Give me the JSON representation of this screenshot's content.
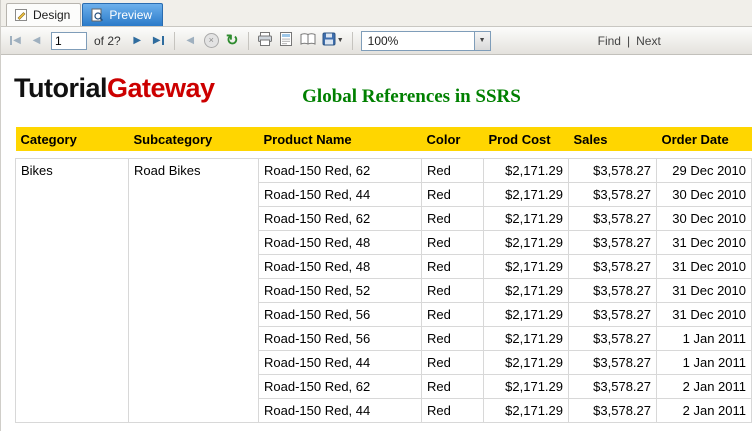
{
  "window": {
    "tabs": {
      "design": "Design",
      "preview": "Preview"
    }
  },
  "toolbar": {
    "page_number": "1",
    "page_count_label": "of 2?",
    "zoom_value": "100%",
    "find_label": "Find",
    "find_separator": "|",
    "next_label": "Next",
    "icons": {
      "first_page": "◀",
      "prev_page": "◀",
      "next_page": "▶",
      "last_page": "▶",
      "back_parent": "◀",
      "stop": "×",
      "refresh": "↻",
      "export_dropdown": "▼",
      "zoom_dropdown": "▼"
    }
  },
  "report": {
    "logo_part1": "Tutorial",
    "logo_part2": "Gateway",
    "title": "Global References in SSRS",
    "colors": {
      "logo_accent": "#CC0000",
      "title_green": "#008000",
      "header_yellow": "#FFD600",
      "active_tab_blue": "#2B7BC8"
    }
  },
  "table": {
    "headers": [
      "Category",
      "Subcategory",
      "Product Name",
      "Color",
      "Prod Cost",
      "Sales",
      "Order Date"
    ],
    "group": {
      "category": "Bikes",
      "subcategory": "Road Bikes"
    },
    "rows": [
      [
        "Road-150 Red, 62",
        "Red",
        "$2,171.29",
        "$3,578.27",
        "29 Dec 2010"
      ],
      [
        "Road-150 Red, 44",
        "Red",
        "$2,171.29",
        "$3,578.27",
        "30 Dec 2010"
      ],
      [
        "Road-150 Red, 62",
        "Red",
        "$2,171.29",
        "$3,578.27",
        "30 Dec 2010"
      ],
      [
        "Road-150 Red, 48",
        "Red",
        "$2,171.29",
        "$3,578.27",
        "31 Dec 2010"
      ],
      [
        "Road-150 Red, 48",
        "Red",
        "$2,171.29",
        "$3,578.27",
        "31 Dec 2010"
      ],
      [
        "Road-150 Red, 52",
        "Red",
        "$2,171.29",
        "$3,578.27",
        "31 Dec 2010"
      ],
      [
        "Road-150 Red, 56",
        "Red",
        "$2,171.29",
        "$3,578.27",
        "31 Dec 2010"
      ],
      [
        "Road-150 Red, 56",
        "Red",
        "$2,171.29",
        "$3,578.27",
        "1 Jan 2011"
      ],
      [
        "Road-150 Red, 44",
        "Red",
        "$2,171.29",
        "$3,578.27",
        "1 Jan 2011"
      ],
      [
        "Road-150 Red, 62",
        "Red",
        "$2,171.29",
        "$3,578.27",
        "2 Jan 2011"
      ],
      [
        "Road-150 Red, 44",
        "Red",
        "$2,171.29",
        "$3,578.27",
        "2 Jan 2011"
      ]
    ]
  }
}
